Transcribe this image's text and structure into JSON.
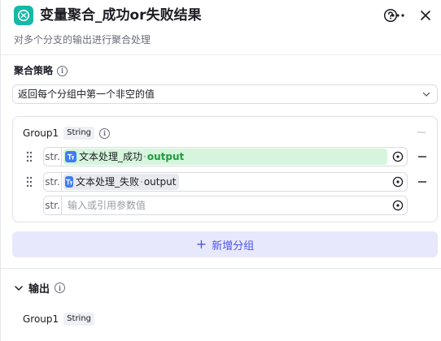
{
  "header": {
    "title": "变量聚合_成功or失败结果",
    "subtitle": "对多个分支的输出进行聚合处理",
    "icons": [
      "variable-merge-icon",
      "help-icon",
      "more-icon",
      "close-icon"
    ]
  },
  "strategy": {
    "label": "聚合策略",
    "selected": "返回每个分组中第一个非空的值"
  },
  "groups": [
    {
      "name": "Group1",
      "type": "String",
      "rows": [
        {
          "type_tag": "str.",
          "node": "文本处理_成功",
          "sep": "·",
          "variable": "output",
          "status": "success"
        },
        {
          "type_tag": "str.",
          "node": "文本处理_失败",
          "sep": "·",
          "variable": "output",
          "status": "normal"
        },
        {
          "type_tag": "str.",
          "placeholder": "输入或引用参数值"
        }
      ]
    }
  ],
  "add_group_label": "新增分组",
  "output": {
    "label": "输出",
    "items": [
      {
        "name": "Group1",
        "type": "String"
      }
    ]
  },
  "colors": {
    "accent": "#4d53e8",
    "node_icon": "#16b8a6",
    "ref_success_bg": "#d5f5dc",
    "ref_success_text": "#1f9a3e"
  }
}
